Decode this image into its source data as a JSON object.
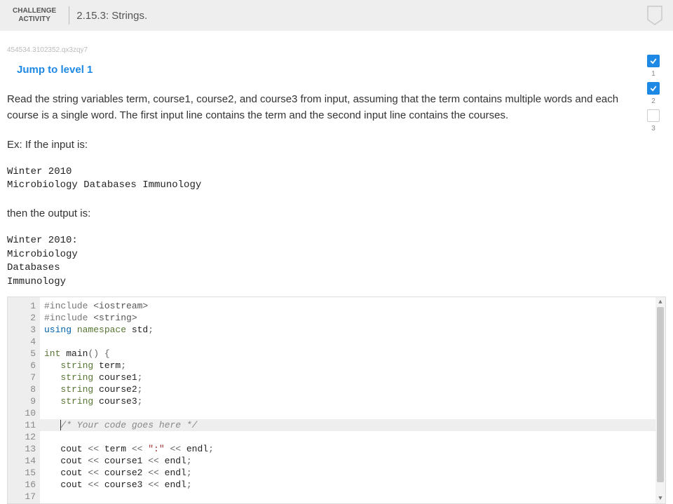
{
  "header": {
    "badge_line1": "CHALLENGE",
    "badge_line2": "ACTIVITY",
    "title": "2.15.3: Strings."
  },
  "session_id": "454534.3102352.qx3zqy7",
  "link_label": "Jump to level 1",
  "description": "Read the string variables term, course1, course2, and course3 from input, assuming that the term contains multiple words and each course is a single word. The first input line contains the term and the second input line contains the courses.",
  "example_intro": "Ex: If the input is:",
  "input_example": "Winter 2010\nMicrobiology Databases Immunology",
  "output_intro": "then the output is:",
  "output_example": "Winter 2010:\nMicrobiology\nDatabases\nImmunology",
  "progress": {
    "items": [
      {
        "num": "1",
        "state": "active"
      },
      {
        "num": "2",
        "state": "active"
      },
      {
        "num": "3",
        "state": "inactive"
      }
    ]
  },
  "code": {
    "active_line": 11,
    "lines": [
      {
        "n": "1",
        "tokens": [
          {
            "c": "kw-include",
            "t": "#include "
          },
          {
            "c": "kw-string-lit",
            "t": "<iostream>"
          }
        ]
      },
      {
        "n": "2",
        "tokens": [
          {
            "c": "kw-include",
            "t": "#include "
          },
          {
            "c": "kw-string-lit",
            "t": "<string>"
          }
        ]
      },
      {
        "n": "3",
        "tokens": [
          {
            "c": "kw-blue",
            "t": "using "
          },
          {
            "c": "kw-type",
            "t": "namespace "
          },
          {
            "c": "kw-std",
            "t": "std"
          },
          {
            "c": "kw-punct",
            "t": ";"
          }
        ]
      },
      {
        "n": "4",
        "tokens": []
      },
      {
        "n": "5",
        "tokens": [
          {
            "c": "kw-type",
            "t": "int "
          },
          {
            "c": "kw-ident",
            "t": "main"
          },
          {
            "c": "kw-punct",
            "t": "() {"
          }
        ]
      },
      {
        "n": "6",
        "tokens": [
          {
            "c": "",
            "t": "   "
          },
          {
            "c": "kw-type",
            "t": "string"
          },
          {
            "c": "kw-ident",
            "t": " term"
          },
          {
            "c": "kw-punct",
            "t": ";"
          }
        ]
      },
      {
        "n": "7",
        "tokens": [
          {
            "c": "",
            "t": "   "
          },
          {
            "c": "kw-type",
            "t": "string"
          },
          {
            "c": "kw-ident",
            "t": " course1"
          },
          {
            "c": "kw-punct",
            "t": ";"
          }
        ]
      },
      {
        "n": "8",
        "tokens": [
          {
            "c": "",
            "t": "   "
          },
          {
            "c": "kw-type",
            "t": "string"
          },
          {
            "c": "kw-ident",
            "t": " course2"
          },
          {
            "c": "kw-punct",
            "t": ";"
          }
        ]
      },
      {
        "n": "9",
        "tokens": [
          {
            "c": "",
            "t": "   "
          },
          {
            "c": "kw-type",
            "t": "string"
          },
          {
            "c": "kw-ident",
            "t": " course3"
          },
          {
            "c": "kw-punct",
            "t": ";"
          }
        ]
      },
      {
        "n": "10",
        "tokens": []
      },
      {
        "n": "11",
        "tokens": [
          {
            "c": "",
            "t": "   "
          },
          {
            "c": "kw-comment",
            "t": "/* Your code goes here */"
          }
        ]
      },
      {
        "n": "12",
        "tokens": []
      },
      {
        "n": "13",
        "tokens": [
          {
            "c": "",
            "t": "   "
          },
          {
            "c": "kw-ident",
            "t": "cout "
          },
          {
            "c": "kw-punct",
            "t": "<< "
          },
          {
            "c": "kw-ident",
            "t": "term "
          },
          {
            "c": "kw-punct",
            "t": "<< "
          },
          {
            "c": "kw-str",
            "t": "\":\" "
          },
          {
            "c": "kw-punct",
            "t": "<< "
          },
          {
            "c": "kw-ident",
            "t": "endl"
          },
          {
            "c": "kw-punct",
            "t": ";"
          }
        ]
      },
      {
        "n": "14",
        "tokens": [
          {
            "c": "",
            "t": "   "
          },
          {
            "c": "kw-ident",
            "t": "cout "
          },
          {
            "c": "kw-punct",
            "t": "<< "
          },
          {
            "c": "kw-ident",
            "t": "course1 "
          },
          {
            "c": "kw-punct",
            "t": "<< "
          },
          {
            "c": "kw-ident",
            "t": "endl"
          },
          {
            "c": "kw-punct",
            "t": ";"
          }
        ]
      },
      {
        "n": "15",
        "tokens": [
          {
            "c": "",
            "t": "   "
          },
          {
            "c": "kw-ident",
            "t": "cout "
          },
          {
            "c": "kw-punct",
            "t": "<< "
          },
          {
            "c": "kw-ident",
            "t": "course2 "
          },
          {
            "c": "kw-punct",
            "t": "<< "
          },
          {
            "c": "kw-ident",
            "t": "endl"
          },
          {
            "c": "kw-punct",
            "t": ";"
          }
        ]
      },
      {
        "n": "16",
        "tokens": [
          {
            "c": "",
            "t": "   "
          },
          {
            "c": "kw-ident",
            "t": "cout "
          },
          {
            "c": "kw-punct",
            "t": "<< "
          },
          {
            "c": "kw-ident",
            "t": "course3 "
          },
          {
            "c": "kw-punct",
            "t": "<< "
          },
          {
            "c": "kw-ident",
            "t": "endl"
          },
          {
            "c": "kw-punct",
            "t": ";"
          }
        ]
      },
      {
        "n": "17",
        "tokens": []
      }
    ]
  }
}
